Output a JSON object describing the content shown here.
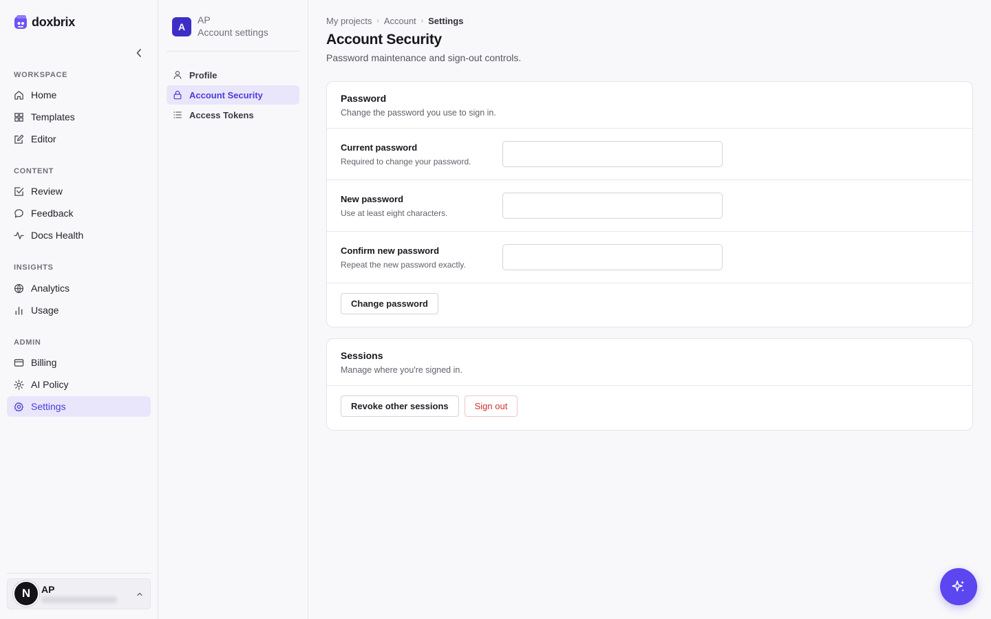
{
  "brand": {
    "name": "doxbrix",
    "accent": "#5b46f0"
  },
  "sidebar": {
    "sections": [
      {
        "title": "WORKSPACE",
        "items": [
          {
            "label": "Home",
            "icon": "home-icon"
          },
          {
            "label": "Templates",
            "icon": "templates-icon"
          },
          {
            "label": "Editor",
            "icon": "edit-icon"
          }
        ]
      },
      {
        "title": "CONTENT",
        "items": [
          {
            "label": "Review",
            "icon": "check-square-icon"
          },
          {
            "label": "Feedback",
            "icon": "message-icon"
          },
          {
            "label": "Docs Health",
            "icon": "activity-icon"
          }
        ]
      },
      {
        "title": "INSIGHTS",
        "items": [
          {
            "label": "Analytics",
            "icon": "globe-icon"
          },
          {
            "label": "Usage",
            "icon": "bar-chart-icon"
          }
        ]
      },
      {
        "title": "ADMIN",
        "items": [
          {
            "label": "Billing",
            "icon": "credit-card-icon"
          },
          {
            "label": "AI Policy",
            "icon": "sun-icon"
          },
          {
            "label": "Settings",
            "icon": "gear-icon",
            "active": true
          }
        ]
      }
    ],
    "user": {
      "avatar_letter": "N",
      "name": "AP"
    }
  },
  "settings_panel": {
    "avatar_letter": "A",
    "initials": "AP",
    "subtitle": "Account settings",
    "items": [
      {
        "label": "Profile",
        "icon": "user-icon"
      },
      {
        "label": "Account Security",
        "icon": "lock-icon",
        "active": true
      },
      {
        "label": "Access Tokens",
        "icon": "list-icon"
      }
    ]
  },
  "breadcrumb": [
    "My projects",
    "Account",
    "Settings"
  ],
  "page": {
    "title": "Account Security",
    "subtitle": "Password maintenance and sign-out controls."
  },
  "password_card": {
    "title": "Password",
    "description": "Change the password you use to sign in.",
    "fields": [
      {
        "label": "Current password",
        "help": "Required to change your password.",
        "value": ""
      },
      {
        "label": "New password",
        "help": "Use at least eight characters.",
        "value": ""
      },
      {
        "label": "Confirm new password",
        "help": "Repeat the new password exactly.",
        "value": ""
      }
    ],
    "submit_label": "Change password"
  },
  "sessions_card": {
    "title": "Sessions",
    "description": "Manage where you're signed in.",
    "revoke_label": "Revoke other sessions",
    "signout_label": "Sign out"
  }
}
